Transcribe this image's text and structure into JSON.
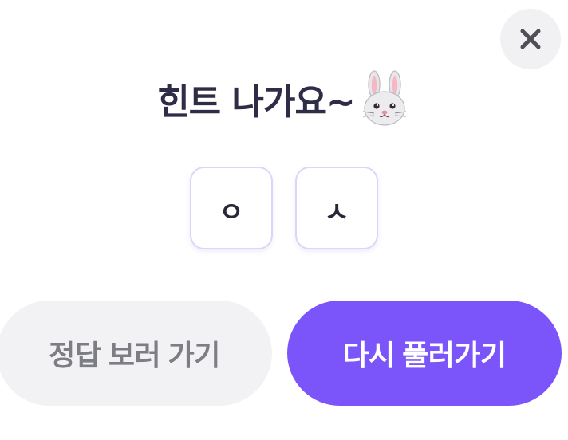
{
  "modal": {
    "title": "힌트 나가요~",
    "title_emoji_icon": "rabbit-face-icon",
    "close_icon": "close-icon"
  },
  "hints": [
    {
      "char": "ㅇ"
    },
    {
      "char": "ㅅ"
    }
  ],
  "buttons": {
    "view_answer_label": "정답 보러 가기",
    "retry_label": "다시 풀러가기"
  },
  "colors": {
    "title": "#2f2c47",
    "accent": "#7b55fa",
    "secondary_bg": "#f2f2f4",
    "secondary_text": "#7d7d84",
    "tile_border": "#dcd6fa"
  }
}
